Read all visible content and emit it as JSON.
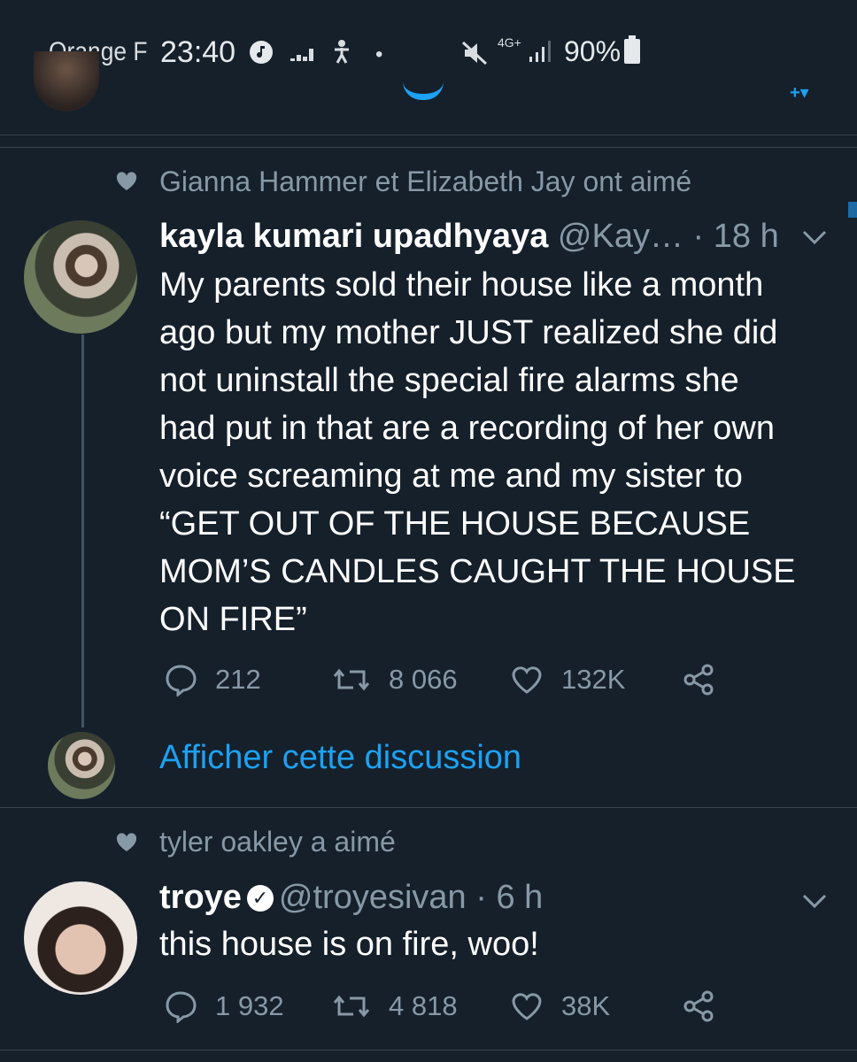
{
  "status_bar": {
    "carrier": "Orange F",
    "time": "23:40",
    "battery": "90%",
    "network": "4G+"
  },
  "tweets": [
    {
      "social_context": "Gianna Hammer et Elizabeth Jay ont aimé",
      "name": "kayla kumari upadhyaya",
      "handle": "@Kay…",
      "time": " · 18 h",
      "text_lines": [
        "My parents sold their house like a month",
        "ago but my mother JUST realized she did",
        "not uninstall the special fire alarms she",
        "had put in that are a recording of her own",
        "voice screaming at me and my sister to",
        "“GET OUT OF THE HOUSE BECAUSE",
        "MOM’S CANDLES CAUGHT THE HOUSE",
        "ON FIRE”"
      ],
      "replies": "212",
      "retweets": "8 066",
      "likes": "132K",
      "show_thread": "Afficher cette discussion"
    },
    {
      "social_context": "tyler oakley a aimé",
      "name": "troye",
      "handle": "@troyesivan",
      "time": " · 6 h",
      "text_lines": [
        "this house is on fire, woo!"
      ],
      "replies": "1 932",
      "retweets": "4 818",
      "likes": "38K"
    }
  ],
  "icons": {
    "reply": "reply-icon",
    "retweet": "retweet-icon",
    "like": "heart-icon",
    "share": "share-icon",
    "caret": "chevron-down-icon",
    "verified": "verified-badge-icon"
  },
  "colors": {
    "background": "#15202b",
    "accent": "#1da1f2",
    "secondary_text": "#8899a6",
    "divider": "#38444d"
  }
}
